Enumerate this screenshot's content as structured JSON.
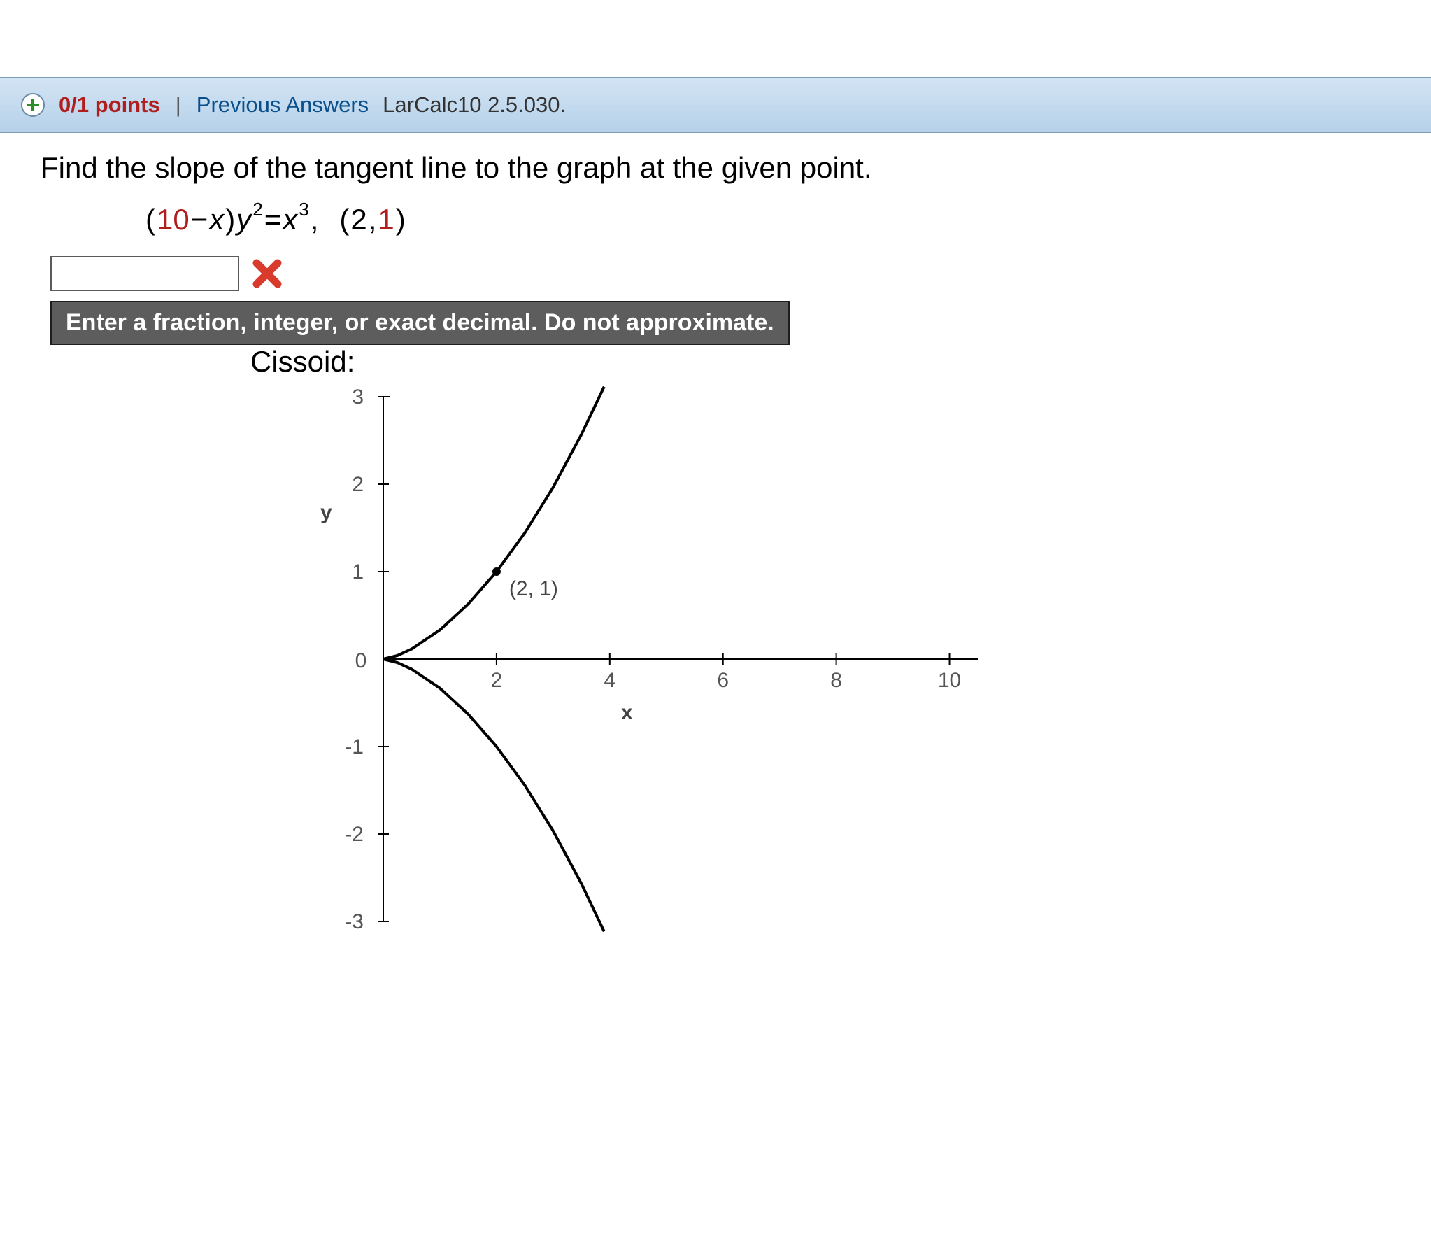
{
  "header": {
    "points": "0/1 points",
    "previous_link": "Previous Answers",
    "source": "LarCalc10 2.5.030."
  },
  "prompt": "Find the slope of the tangent line to the graph at the given point.",
  "equation": {
    "open": "(",
    "const": "10",
    "minus": " − ",
    "x1": "x",
    "close1": ")",
    "y": "y",
    "ysup": "2",
    "eq": " = ",
    "x2": "x",
    "xsup": "3",
    "comma": " ,",
    "point_open": "(",
    "pt_x": "2",
    "pt_sep": ", ",
    "pt_y": "1",
    "point_close": ")"
  },
  "answer": {
    "value": ""
  },
  "icons": {
    "wrong": "wrong-x"
  },
  "hint": "Enter a fraction, integer, or exact decimal. Do not approximate.",
  "graph": {
    "title": "Cissoid:",
    "point_label": "(2, 1)"
  },
  "chart_data": {
    "type": "line",
    "title": "Cissoid:",
    "xlabel": "x",
    "ylabel": "y",
    "xlim": [
      0,
      10.5
    ],
    "ylim": [
      -3,
      3
    ],
    "x_ticks": [
      0,
      2,
      4,
      6,
      8,
      10
    ],
    "y_ticks": [
      -3,
      -2,
      -1,
      0,
      1,
      2,
      3
    ],
    "annotations": [
      {
        "x": 2,
        "y": 1,
        "text": "(2, 1)",
        "marker": true
      }
    ],
    "series": [
      {
        "name": "upper branch",
        "x": [
          0.0,
          0.25,
          0.5,
          1.0,
          1.5,
          2.0,
          2.5,
          3.0,
          3.5,
          3.9
        ],
        "values": [
          0.0,
          0.04,
          0.115,
          0.333,
          0.63,
          1.0,
          1.443,
          1.964,
          2.569,
          3.114
        ]
      },
      {
        "name": "lower branch",
        "x": [
          0.0,
          0.25,
          0.5,
          1.0,
          1.5,
          2.0,
          2.5,
          3.0,
          3.5,
          3.9
        ],
        "values": [
          0.0,
          -0.04,
          -0.115,
          -0.333,
          -0.63,
          -1.0,
          -1.443,
          -1.964,
          -2.569,
          -3.114
        ]
      }
    ]
  }
}
